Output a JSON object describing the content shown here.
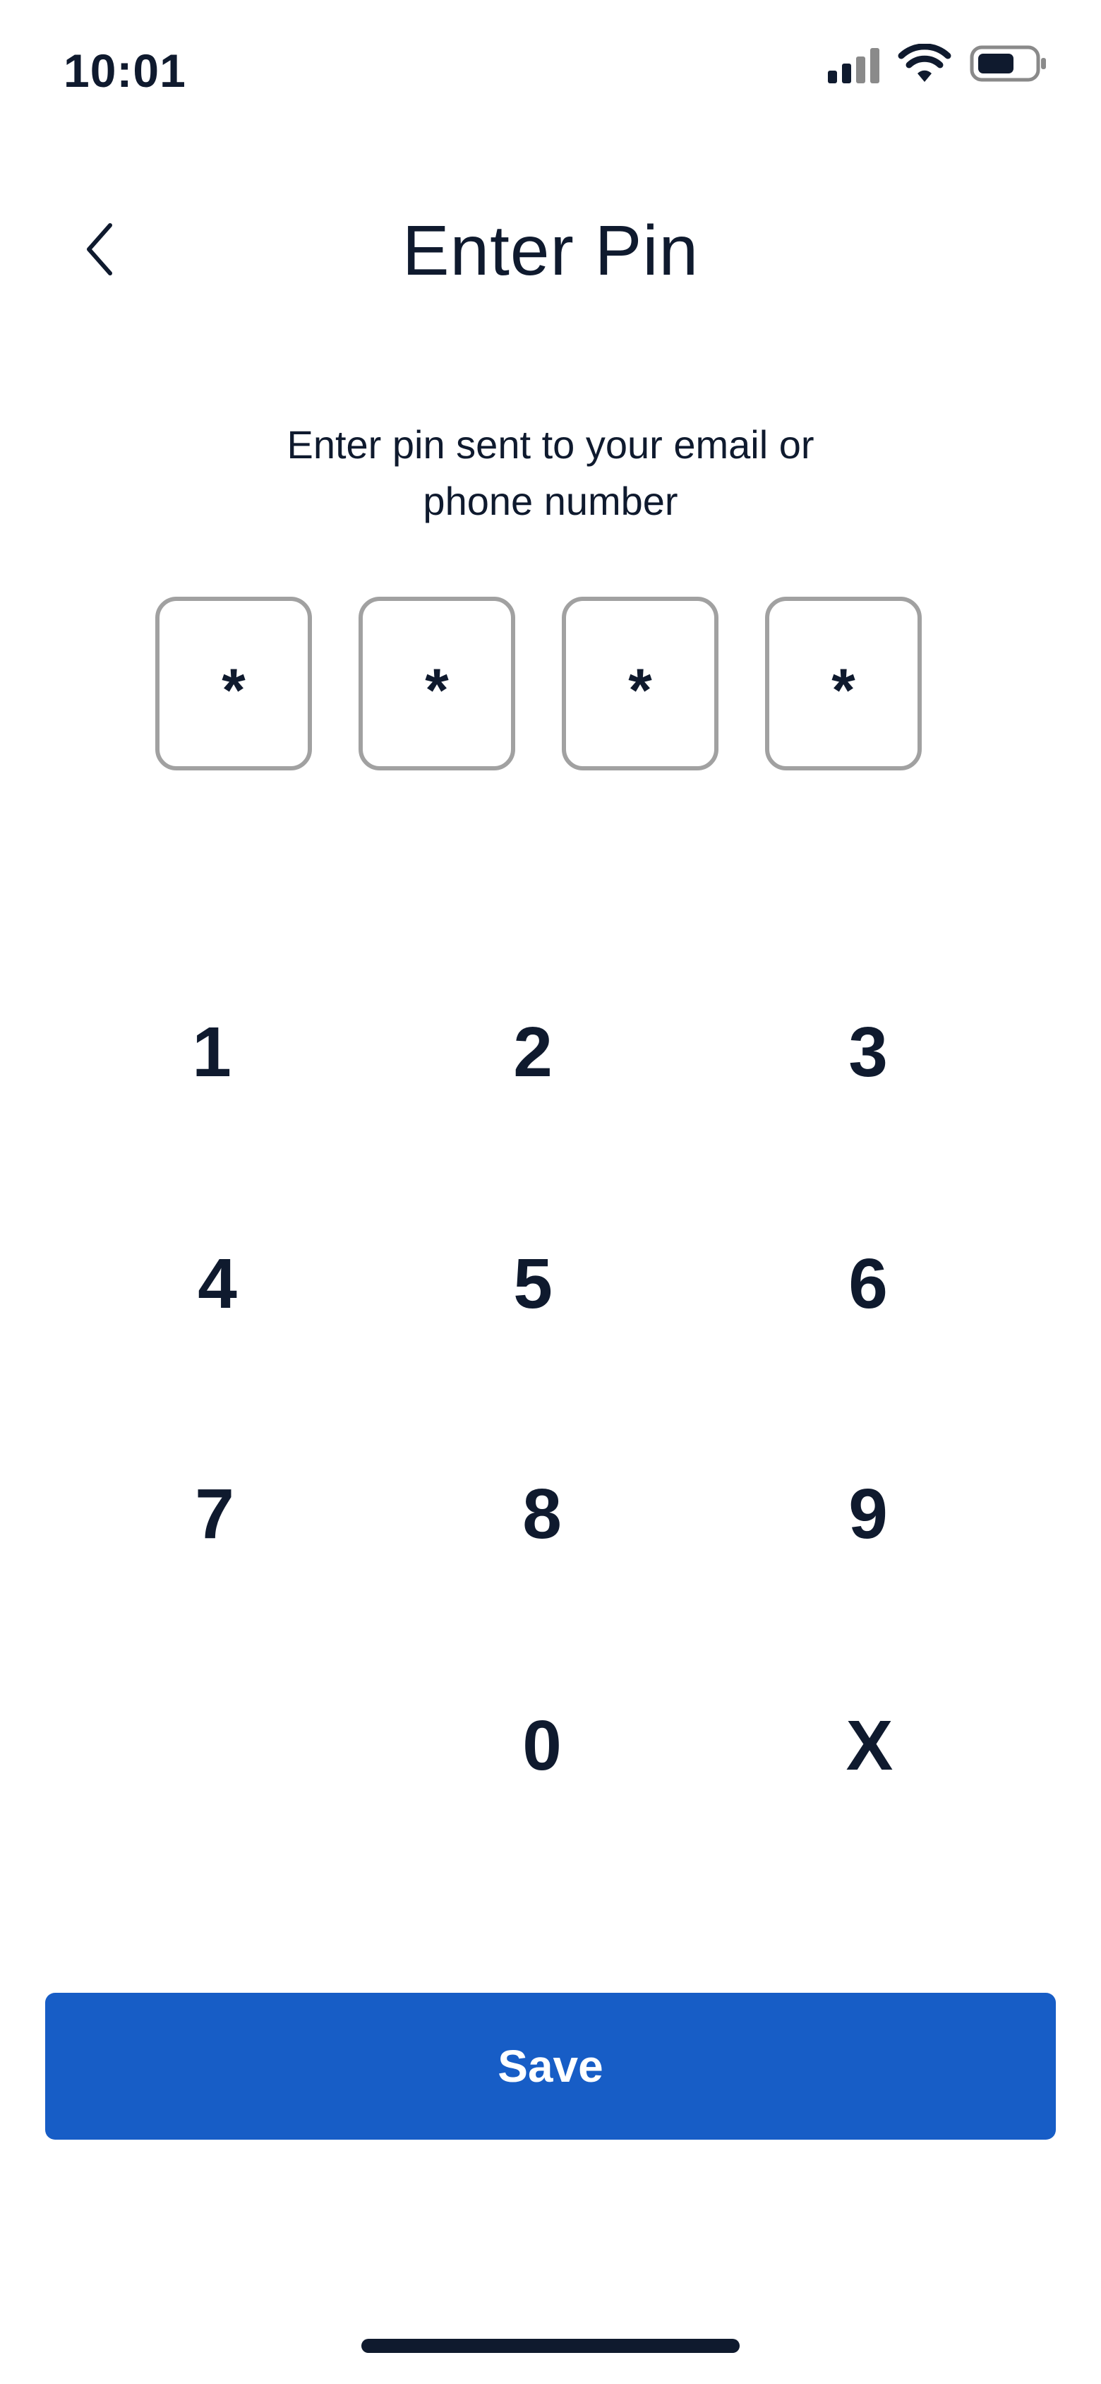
{
  "status_bar": {
    "time": "10:01",
    "icons": [
      "signal-icon",
      "wifi-icon",
      "battery-icon"
    ]
  },
  "header": {
    "back_icon": "chevron-left-icon",
    "title": "Enter Pin"
  },
  "instruction": {
    "line1": "Enter pin sent to your email or",
    "line2": "phone number"
  },
  "pin": {
    "digits": [
      "*",
      "*",
      "*",
      "*"
    ]
  },
  "keypad": {
    "keys": [
      "1",
      "2",
      "3",
      "4",
      "5",
      "6",
      "7",
      "8",
      "9",
      "0",
      "X"
    ]
  },
  "save_button": {
    "label": "Save"
  },
  "colors": {
    "primary": "#175dc6",
    "text": "#0f1a2e",
    "pin_border": "#a1a1a1"
  }
}
